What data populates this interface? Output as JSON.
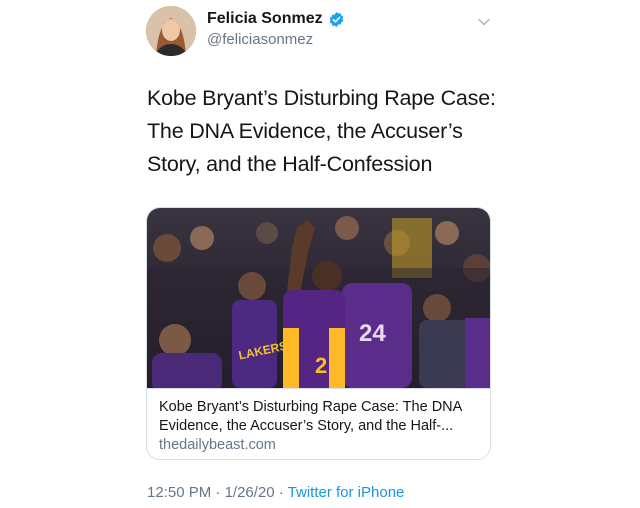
{
  "user": {
    "display_name": "Felicia Sonmez",
    "handle": "@feliciasonmez",
    "verified": true
  },
  "icons": {
    "verified": "verified-badge-icon",
    "menu": "chevron-down-icon"
  },
  "tweet": {
    "lines": [
      "Kobe Bryant’s Disturbing Rape Case:",
      "The DNA Evidence, the Accuser’s",
      "Story, and the Half-Confession"
    ]
  },
  "card": {
    "title_lines": [
      "Kobe Bryant’s Disturbing Rape Case: The DNA",
      "Evidence, the Accuser’s Story, and the Half-..."
    ],
    "domain": "thedailybeast.com",
    "image": {
      "jersey_text": "LAKERS",
      "jersey_number": "24"
    }
  },
  "meta": {
    "time": "12:50 PM",
    "date": "1/26/20",
    "separator": " · ",
    "source": "Twitter for iPhone"
  },
  "colors": {
    "accent": "#1da1f2",
    "secondary_text": "#657786",
    "lakers_purple": "#552583",
    "lakers_gold": "#fdb927"
  }
}
